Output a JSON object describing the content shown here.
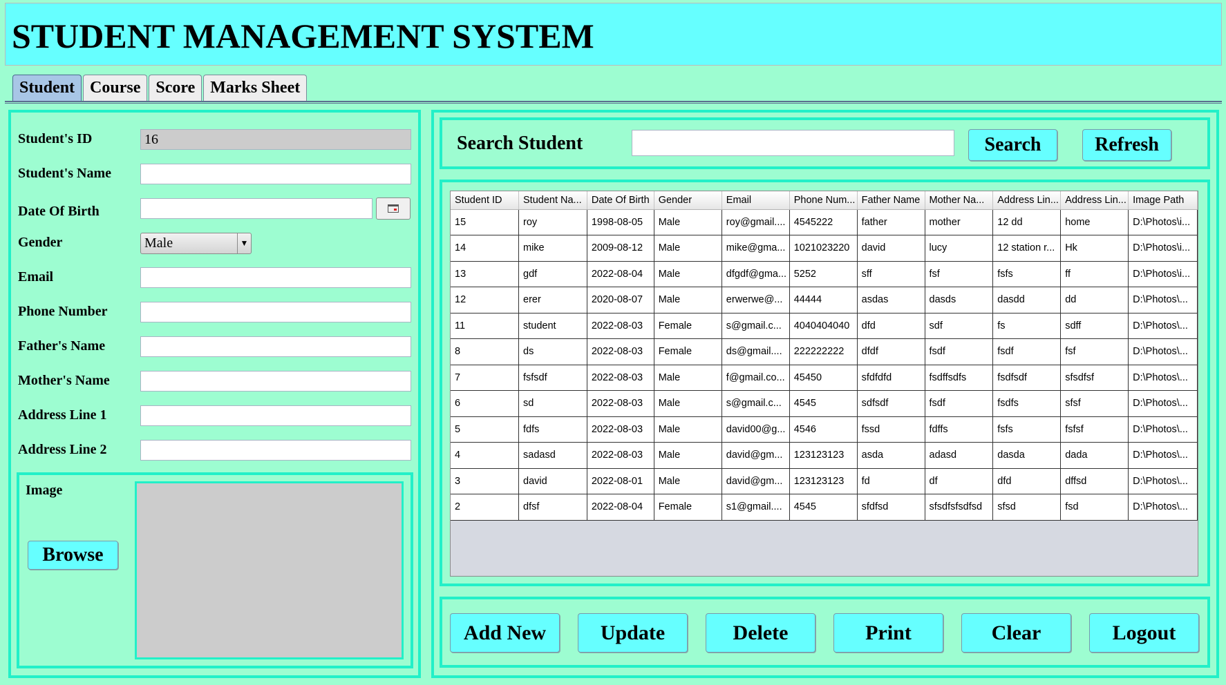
{
  "app": {
    "title": "STUDENT MANAGEMENT SYSTEM"
  },
  "tabs": [
    {
      "label": "Student",
      "active": true
    },
    {
      "label": "Course",
      "active": false
    },
    {
      "label": "Score",
      "active": false
    },
    {
      "label": "Marks Sheet",
      "active": false
    }
  ],
  "form": {
    "student_id": {
      "label": "Student's ID",
      "value": "16"
    },
    "student_name": {
      "label": "Student's Name",
      "value": ""
    },
    "date_of_birth": {
      "label": "Date Of Birth",
      "value": ""
    },
    "gender": {
      "label": "Gender",
      "value": "Male"
    },
    "email": {
      "label": "Email",
      "value": ""
    },
    "phone": {
      "label": "Phone Number",
      "value": ""
    },
    "father_name": {
      "label": "Father's Name",
      "value": ""
    },
    "mother_name": {
      "label": "Mother's Name",
      "value": ""
    },
    "address1": {
      "label": "Address Line 1",
      "value": ""
    },
    "address2": {
      "label": "Address Line 2",
      "value": ""
    },
    "image_label": "Image",
    "browse_label": "Browse"
  },
  "search": {
    "label": "Search Student",
    "value": "",
    "search_button": "Search",
    "refresh_button": "Refresh"
  },
  "table": {
    "columns": [
      "Student ID",
      "Student Na...",
      "Date Of Birth",
      "Gender",
      "Email",
      "Phone Num...",
      "Father Name",
      "Mother Na...",
      "Address Lin...",
      "Address Lin...",
      "Image Path"
    ],
    "rows": [
      [
        "15",
        "roy",
        "1998-08-05",
        "Male",
        "roy@gmail....",
        "4545222",
        "father",
        "mother",
        "12 dd",
        "home",
        "D:\\Photos\\i..."
      ],
      [
        "14",
        "mike",
        "2009-08-12",
        "Male",
        "mike@gma...",
        "1021023220",
        "david",
        "lucy",
        "12 station r...",
        "Hk",
        "D:\\Photos\\i..."
      ],
      [
        "13",
        "gdf",
        "2022-08-04",
        "Male",
        "dfgdf@gma...",
        "5252",
        "sff",
        "fsf",
        "fsfs",
        "ff",
        "D:\\Photos\\i..."
      ],
      [
        "12",
        "erer",
        "2020-08-07",
        "Male",
        "erwerwe@...",
        "44444",
        "asdas",
        "dasds",
        "dasdd",
        "dd",
        "D:\\Photos\\..."
      ],
      [
        "11",
        "student",
        "2022-08-03",
        "Female",
        "s@gmail.c...",
        "4040404040",
        "dfd",
        "sdf",
        "fs",
        "sdff",
        "D:\\Photos\\..."
      ],
      [
        "8",
        "ds",
        "2022-08-03",
        "Female",
        "ds@gmail....",
        "222222222",
        "dfdf",
        "fsdf",
        "fsdf",
        "fsf",
        "D:\\Photos\\..."
      ],
      [
        "7",
        "fsfsdf",
        "2022-08-03",
        "Male",
        "f@gmail.co...",
        "45450",
        "sfdfdfd",
        "fsdffsdfs",
        "fsdfsdf",
        "sfsdfsf",
        "D:\\Photos\\..."
      ],
      [
        "6",
        "sd",
        "2022-08-03",
        "Male",
        "s@gmail.c...",
        "4545",
        "sdfsdf",
        "fsdf",
        "fsdfs",
        "sfsf",
        "D:\\Photos\\..."
      ],
      [
        "5",
        "fdfs",
        "2022-08-03",
        "Male",
        "david00@g...",
        "4546",
        "fssd",
        "fdffs",
        "fsfs",
        "fsfsf",
        "D:\\Photos\\..."
      ],
      [
        "4",
        "sadasd",
        "2022-08-03",
        "Male",
        "david@gm...",
        "123123123",
        "asda",
        "adasd",
        "dasda",
        "dada",
        "D:\\Photos\\..."
      ],
      [
        "3",
        "david",
        "2022-08-01",
        "Male",
        "david@gm...",
        "123123123",
        "fd",
        "df",
        "dfd",
        "dffsd",
        "D:\\Photos\\..."
      ],
      [
        "2",
        "dfsf",
        "2022-08-04",
        "Female",
        "s1@gmail....",
        "4545",
        "sfdfsd",
        "sfsdfsfsdfsd",
        "sfsd",
        "fsd",
        "D:\\Photos\\..."
      ]
    ]
  },
  "actions": {
    "add_new": "Add New",
    "update": "Update",
    "delete": "Delete",
    "print": "Print",
    "clear": "Clear",
    "logout": "Logout"
  }
}
